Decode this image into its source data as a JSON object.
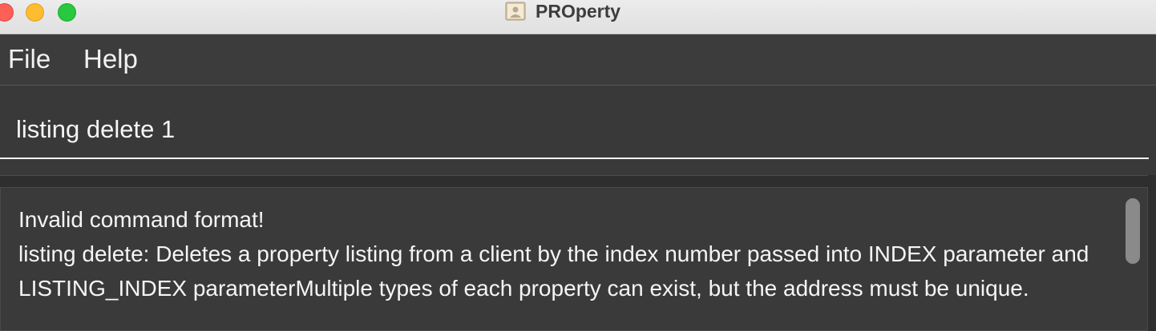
{
  "window": {
    "title": "PROperty",
    "app_icon": "contacts-book-icon"
  },
  "menu": {
    "items": [
      {
        "label": "File"
      },
      {
        "label": "Help"
      }
    ]
  },
  "command_box": {
    "value": "listing delete 1"
  },
  "result_display": {
    "text": "Invalid command format!\nlisting delete: Deletes a property listing from a client by the index number passed into INDEX parameter and LISTING_INDEX parameterMultiple types of each property can exist, but the address must be unique."
  },
  "colors": {
    "background": "#3a3a3a",
    "text": "#f5f5f5",
    "titlebar": "#e6e6e6"
  }
}
